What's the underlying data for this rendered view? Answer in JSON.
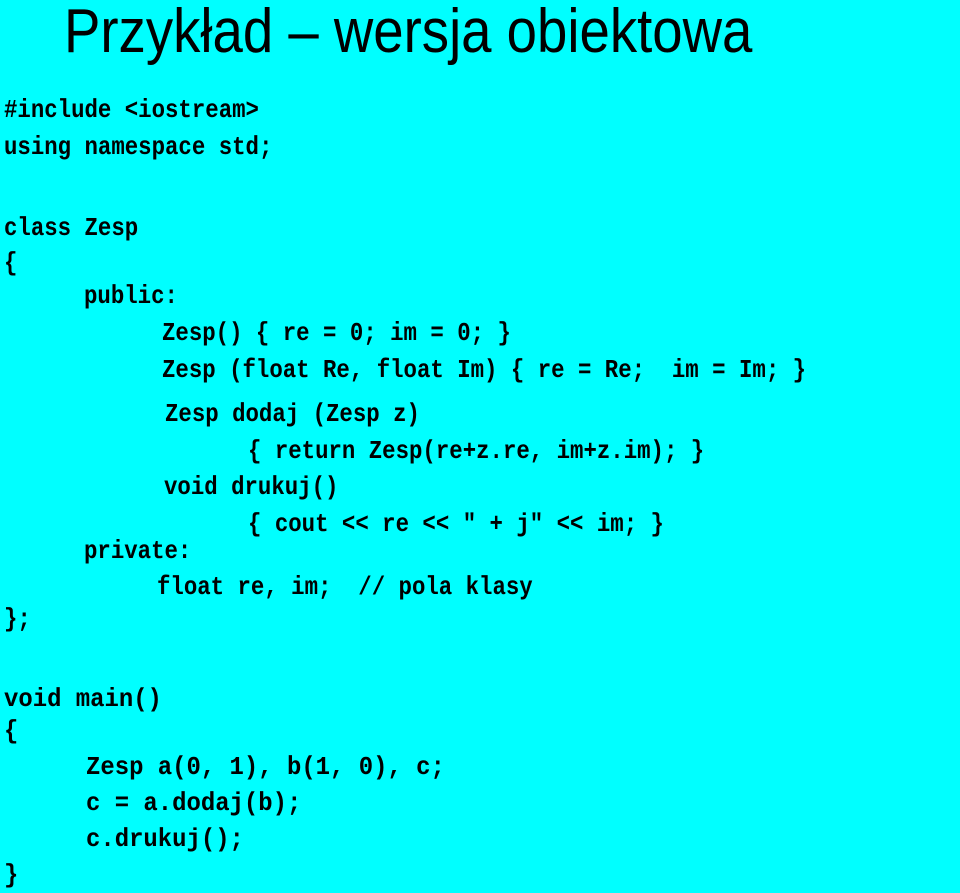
{
  "slide": {
    "title": "Przykład – wersja obiektowa",
    "background_color": "#00ffff",
    "text_color": "#000000"
  },
  "code": {
    "lines": [
      "#include <iostream>",
      "using namespace std;",
      "class Zesp",
      "{",
      "public:",
      "Zesp() { re = 0; im = 0; }",
      "Zesp (float Re, float Im) { re = Re;  im = Im; }",
      "Zesp dodaj (Zesp z)",
      "{ return Zesp(re+z.re, im+z.im); }",
      "void drukuj()",
      "{ cout << re << \" + j\" << im; }",
      "private:",
      "float re, im;  // pola klasy",
      "};",
      "void main()",
      "{",
      "Zesp a(0, 1), b(1, 0), c;",
      "c = a.dodaj(b);",
      "c.drukuj();",
      "}"
    ]
  }
}
